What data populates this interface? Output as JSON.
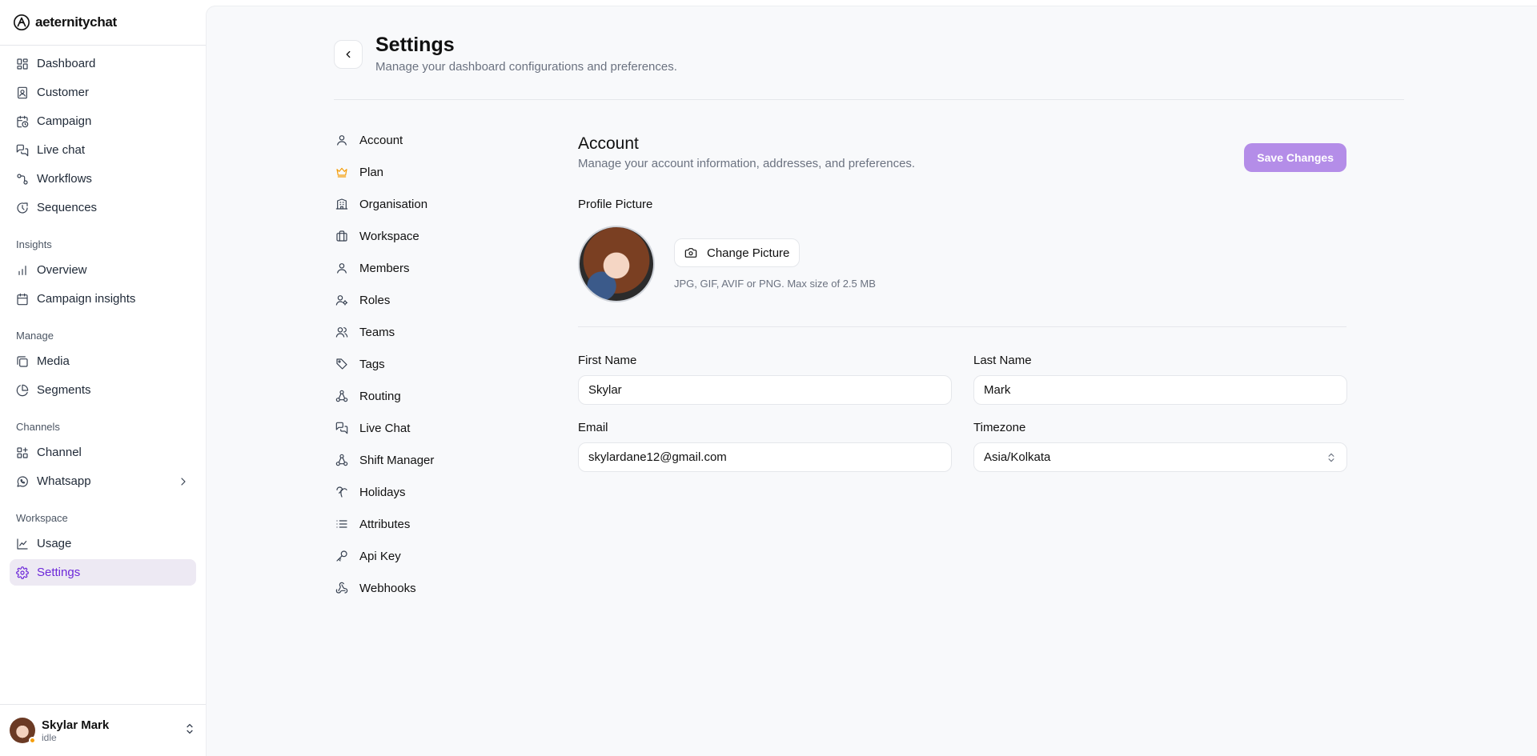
{
  "app": {
    "brand": "aeternitychat"
  },
  "sidebar": {
    "main_items": [
      {
        "label": "Dashboard",
        "icon": "dashboard-icon"
      },
      {
        "label": "Customer",
        "icon": "contact-icon"
      },
      {
        "label": "Campaign",
        "icon": "calendar-clock-icon"
      },
      {
        "label": "Live chat",
        "icon": "chat-bubbles-icon"
      },
      {
        "label": "Workflows",
        "icon": "workflow-icon"
      },
      {
        "label": "Sequences",
        "icon": "sequence-icon"
      }
    ],
    "sections": {
      "insights": "Insights",
      "manage": "Manage",
      "channels": "Channels",
      "workspace": "Workspace"
    },
    "insights_items": [
      {
        "label": "Overview"
      },
      {
        "label": "Campaign insights"
      }
    ],
    "manage_items": [
      {
        "label": "Media"
      },
      {
        "label": "Segments"
      }
    ],
    "channels_items": [
      {
        "label": "Channel"
      },
      {
        "label": "Whatsapp"
      }
    ],
    "workspace_items": [
      {
        "label": "Usage"
      },
      {
        "label": "Settings",
        "active": true
      }
    ],
    "user": {
      "name": "Skylar Mark",
      "status": "idle",
      "status_color": "#f59e0b"
    }
  },
  "header": {
    "title": "Settings",
    "subtitle": "Manage your dashboard configurations and preferences."
  },
  "settings_nav": [
    "Account",
    "Plan",
    "Organisation",
    "Workspace",
    "Members",
    "Roles",
    "Teams",
    "Tags",
    "Routing",
    "Live Chat",
    "Shift Manager",
    "Holidays",
    "Attributes",
    "Api Key",
    "Webhooks"
  ],
  "account": {
    "title": "Account",
    "subtitle": "Manage your account information, addresses, and preferences.",
    "save_label": "Save Changes",
    "profile_picture_label": "Profile Picture",
    "change_picture_label": "Change Picture",
    "picture_hint": "JPG, GIF, AVIF or PNG. Max size of 2.5 MB",
    "fields": {
      "first_name": {
        "label": "First Name",
        "value": "Skylar"
      },
      "last_name": {
        "label": "Last Name",
        "value": "Mark"
      },
      "email": {
        "label": "Email",
        "value": "skylardane12@gmail.com"
      },
      "timezone": {
        "label": "Timezone",
        "value": "Asia/Kolkata"
      }
    }
  },
  "colors": {
    "accent": "#6d28d9",
    "save_button": "#b48de8",
    "active_nav_bg": "#ede9f3",
    "plan_icon": "#f59e0b"
  }
}
